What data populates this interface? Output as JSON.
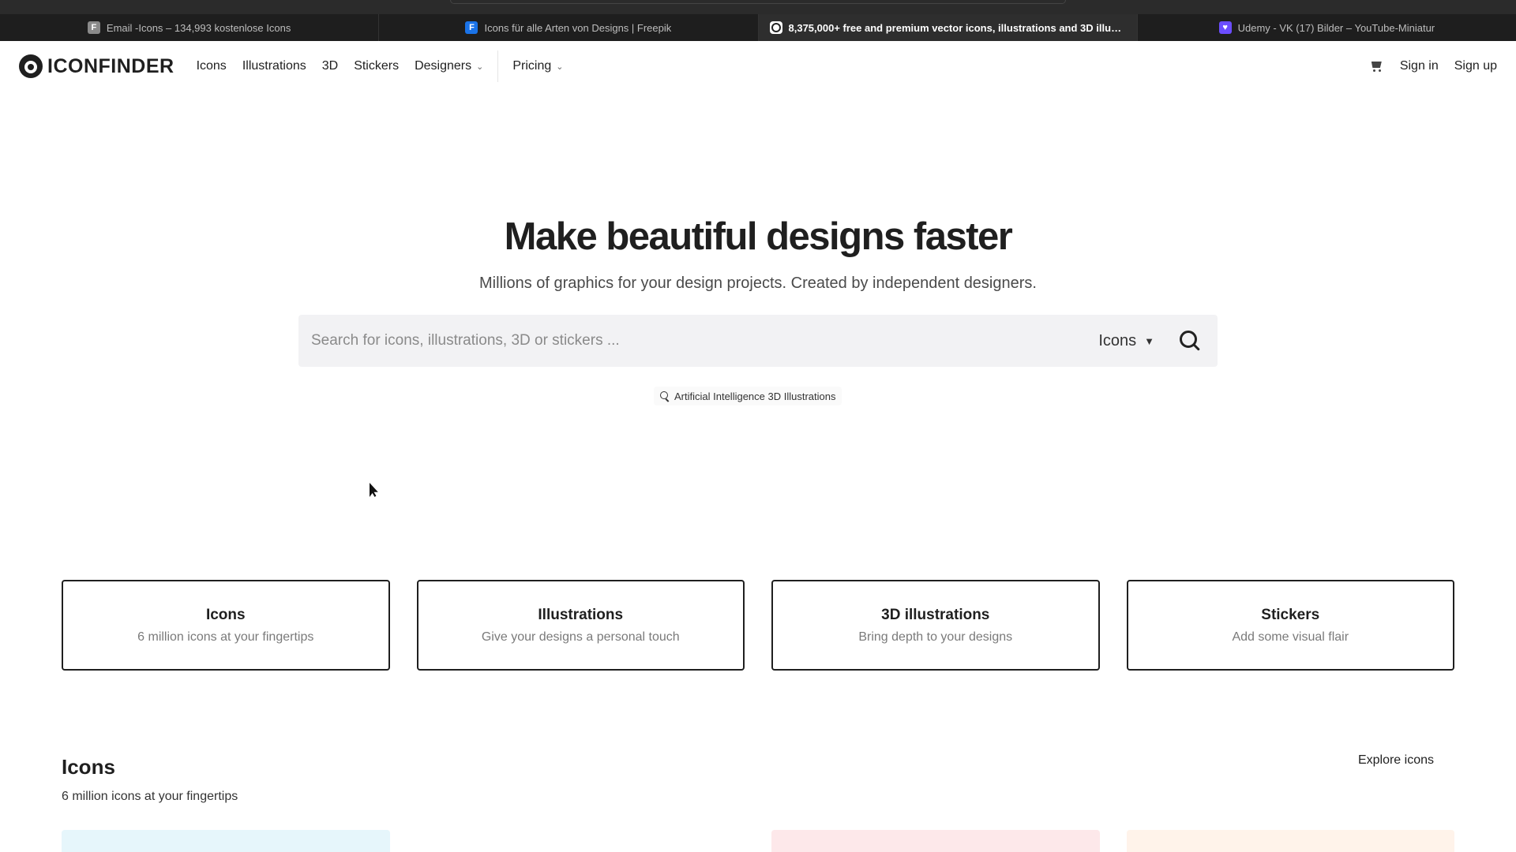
{
  "browser": {
    "tabs": [
      {
        "favicon": "F",
        "title": "Email -Icons – 134,993 kostenlose Icons",
        "active": false
      },
      {
        "favicon": "F",
        "title": "Icons für alle Arten von Designs | Freepik",
        "active": false
      },
      {
        "favicon": "",
        "title": "8,375,000+ free and premium vector icons, illustrations and 3D illust...",
        "active": true
      },
      {
        "favicon": "",
        "title": "Udemy - VK (17) Bilder – YouTube-Miniatur",
        "active": false
      }
    ]
  },
  "nav": {
    "logo_text": "ICONFINDER",
    "links": {
      "icons": "Icons",
      "illustrations": "Illustrations",
      "three_d": "3D",
      "stickers": "Stickers",
      "designers": "Designers",
      "pricing": "Pricing"
    },
    "sign_in": "Sign in",
    "sign_up": "Sign up"
  },
  "hero": {
    "title_pre": "Make ",
    "title_highlight": "beautiful designs",
    "title_post": " faster",
    "subtitle": "Millions of graphics for your design projects. Created by independent designers.",
    "search_placeholder": "Search for icons, illustrations, 3D or stickers ...",
    "search_type": "Icons",
    "suggestion": "Artificial Intelligence 3D Illustrations"
  },
  "categories": [
    {
      "title": "Icons",
      "desc": "6 million icons at your fingertips"
    },
    {
      "title": "Illustrations",
      "desc": "Give your designs a personal touch"
    },
    {
      "title": "3D illustrations",
      "desc": "Bring depth to your designs"
    },
    {
      "title": "Stickers",
      "desc": "Add some visual flair"
    }
  ],
  "icons_section": {
    "title": "Icons",
    "subtitle": "6 million icons at your fingertips",
    "explore_link": "Explore icons"
  },
  "colors": {
    "highlight": "#f7cfa0",
    "thumb_1": "#e6f6fb",
    "thumb_2": "#ffffff",
    "thumb_3": "#fde8ea",
    "thumb_4": "#fff3ea"
  }
}
